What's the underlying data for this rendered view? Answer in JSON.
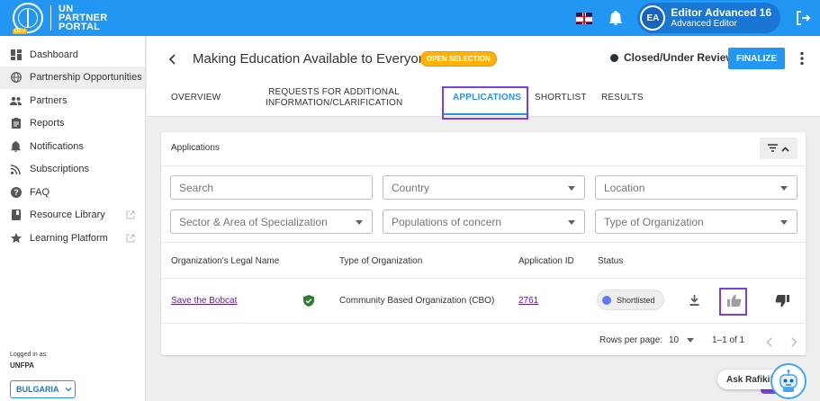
{
  "header": {
    "logo_line1": "UN",
    "logo_line2": "PARTNER",
    "logo_line3": "PORTAL",
    "dev_badge": "DEV",
    "avatar_initials": "EA",
    "user_name": "Editor Advanced 16",
    "user_role": "Advanced Editor"
  },
  "sidebar": {
    "items": [
      {
        "label": "Dashboard",
        "icon": "dashboard-icon"
      },
      {
        "label": "Partnership Opportunities",
        "icon": "globe-icon"
      },
      {
        "label": "Partners",
        "icon": "people-icon"
      },
      {
        "label": "Reports",
        "icon": "clipboard-icon"
      },
      {
        "label": "Notifications",
        "icon": "bell-icon"
      },
      {
        "label": "Subscriptions",
        "icon": "rss-icon"
      },
      {
        "label": "FAQ",
        "icon": "help-icon"
      },
      {
        "label": "Resource Library",
        "icon": "book-icon"
      },
      {
        "label": "Learning Platform",
        "icon": "star-icon"
      }
    ],
    "logged_in_label": "Logged in as:",
    "organization": "UNFPA",
    "country": "BULGARIA"
  },
  "page": {
    "title": "Making Education Available to Everyone",
    "badge": "OPEN SELECTION",
    "status": "Closed/Under Review",
    "finalize_label": "FINALIZE",
    "tabs": [
      {
        "line1": "OVERVIEW",
        "line2": ""
      },
      {
        "line1": "REQUESTS FOR ADDITIONAL",
        "line2": "INFORMATION/CLARIFICATION"
      },
      {
        "line1": "APPLICATIONS",
        "line2": ""
      },
      {
        "line1": "SHORTLIST",
        "line2": ""
      },
      {
        "line1": "RESULTS",
        "line2": ""
      }
    ]
  },
  "applications": {
    "title": "Applications",
    "filters": {
      "search": "Search",
      "country": "Country",
      "location": "Location",
      "sector": "Sector & Area of Specialization",
      "populations": "Populations of concern",
      "org_type": "Type of Organization"
    },
    "columns": [
      "Organization's Legal Name",
      "Type of Organization",
      "Application ID",
      "Status"
    ],
    "rows": [
      {
        "name": "Save the Bobcat",
        "type": "Community Based Organization (CBO)",
        "app_id": "2761",
        "status": "Shortlisted"
      }
    ],
    "rows_per_page_label": "Rows per page:",
    "rows_per_page": "10",
    "range": "1–1 of 1"
  },
  "rafiki": {
    "label": "Ask Rafiki!"
  },
  "colors": {
    "primary": "#2196f3",
    "badge": "#ffb300",
    "highlight": "#7b3fe4",
    "verified": "#2e7d32"
  }
}
